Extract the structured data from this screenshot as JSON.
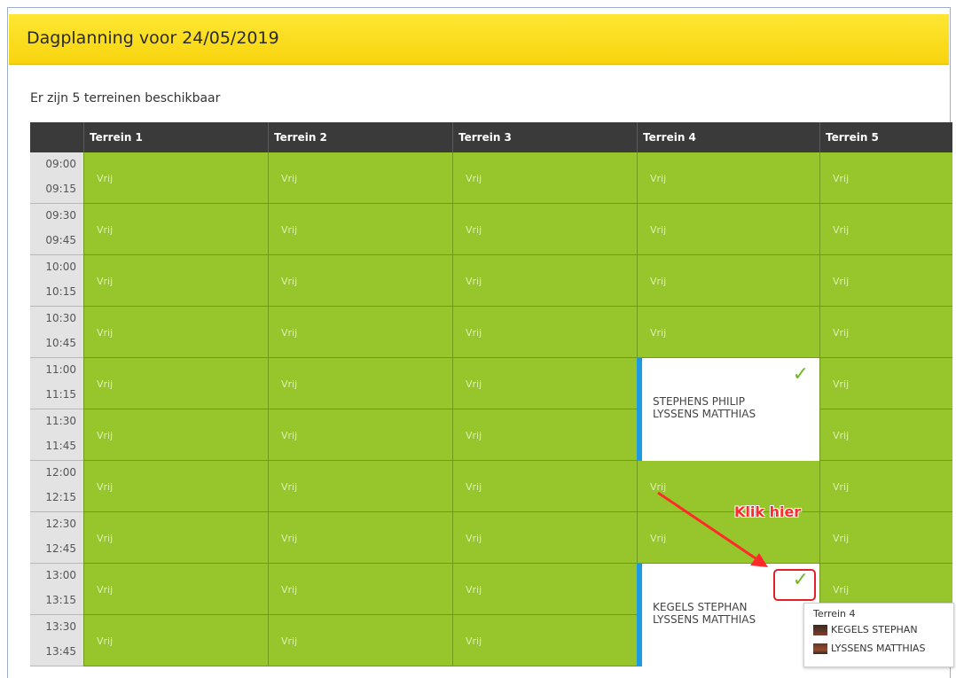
{
  "title": "Dagplanning voor 24/05/2019",
  "subtitle": "Er zijn 5 terreinen beschikbaar",
  "columns": [
    "Terrein 1",
    "Terrein 2",
    "Terrein 3",
    "Terrein 4",
    "Terrein 5"
  ],
  "rows": [
    {
      "t1": "09:00",
      "t2": "09:15",
      "cells": [
        "Vrij",
        "Vrij",
        "Vrij",
        "Vrij",
        "Vrij"
      ]
    },
    {
      "t1": "09:30",
      "t2": "09:45",
      "cells": [
        "Vrij",
        "Vrij",
        "Vrij",
        "Vrij",
        "Vrij"
      ]
    },
    {
      "t1": "10:00",
      "t2": "10:15",
      "cells": [
        "Vrij",
        "Vrij",
        "Vrij",
        "Vrij",
        "Vrij"
      ]
    },
    {
      "t1": "10:30",
      "t2": "10:45",
      "cells": [
        "Vrij",
        "Vrij",
        "Vrij",
        "Vrij",
        "Vrij"
      ]
    },
    {
      "t1": "11:00",
      "t2": "11:15",
      "cells": [
        "Vrij",
        "Vrij",
        "Vrij",
        null,
        "Vrij"
      ]
    },
    {
      "t1": "11:30",
      "t2": "11:45",
      "cells": [
        "Vrij",
        "Vrij",
        "Vrij",
        null,
        "Vrij"
      ]
    },
    {
      "t1": "12:00",
      "t2": "12:15",
      "cells": [
        "Vrij",
        "Vrij",
        "Vrij",
        "Vrij",
        "Vrij"
      ]
    },
    {
      "t1": "12:30",
      "t2": "12:45",
      "cells": [
        "Vrij",
        "Vrij",
        "Vrij",
        "Vrij",
        "Vrij"
      ]
    },
    {
      "t1": "13:00",
      "t2": "13:15",
      "cells": [
        "Vrij",
        "Vrij",
        "Vrij",
        null,
        "Vrij"
      ]
    },
    {
      "t1": "13:30",
      "t2": "13:45",
      "cells": [
        "Vrij",
        "Vrij",
        "Vrij",
        null,
        ""
      ]
    }
  ],
  "bookings": [
    {
      "names": [
        "STEPHENS PHILIP",
        "LYSSENS MATTHIAS"
      ],
      "confirmed_icon": "check-icon"
    },
    {
      "names": [
        "KEGELS STEPHAN",
        "LYSSENS MATTHIAS"
      ],
      "confirmed_icon": "check-icon"
    }
  ],
  "annotation": {
    "text": "Klik hier",
    "color": "#ff2a2a"
  },
  "tooltip": {
    "title": "Terrein 4",
    "players": [
      "KEGELS STEPHAN",
      "LYSSENS MATTHIAS"
    ]
  },
  "colors": {
    "free": "#97c52c",
    "header": "#fde733",
    "booking_accent": "#1e9be0"
  }
}
